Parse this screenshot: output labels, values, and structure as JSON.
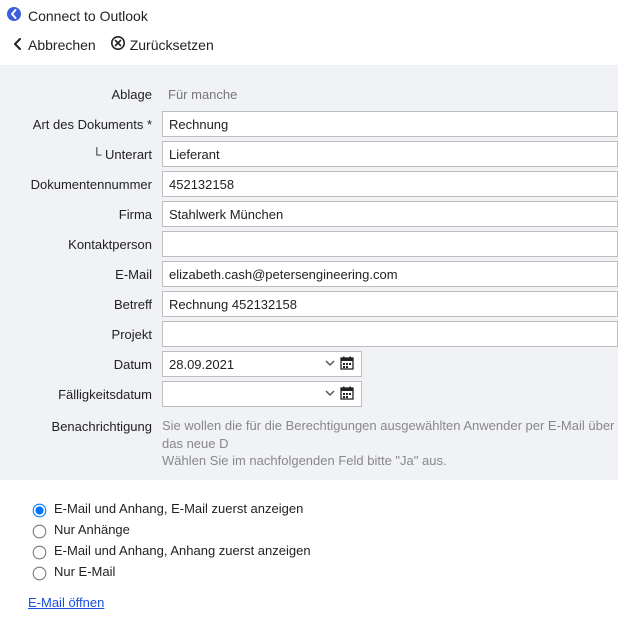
{
  "window": {
    "title": "Connect to Outlook"
  },
  "toolbar": {
    "cancel": "Abbrechen",
    "reset": "Zurücksetzen"
  },
  "form": {
    "ablage": {
      "label": "Ablage",
      "value": "Für manche"
    },
    "art": {
      "label": "Art des Dokuments *",
      "value": "Rechnung"
    },
    "unterart": {
      "label": "└ Unterart",
      "value": "Lieferant"
    },
    "docnum": {
      "label": "Dokumentennummer",
      "value": "452132158"
    },
    "firma": {
      "label": "Firma",
      "value": "Stahlwerk München"
    },
    "kontakt": {
      "label": "Kontaktperson",
      "value": ""
    },
    "email": {
      "label": "E-Mail",
      "value": "elizabeth.cash@petersengineering.com"
    },
    "betreff": {
      "label": "Betreff",
      "value": "Rechnung 452132158"
    },
    "projekt": {
      "label": "Projekt",
      "value": ""
    },
    "datum": {
      "label": "Datum",
      "value": "28.09.2021"
    },
    "faellig": {
      "label": "Fälligkeitsdatum",
      "value": ""
    },
    "benachrichtigung": {
      "label": "Benachrichtigung",
      "line1": "Sie wollen die für die Berechtigungen ausgewählten Anwender per E-Mail über das neue D",
      "line2": "Wählen Sie im nachfolgenden Feld bitte \"Ja\" aus."
    }
  },
  "options": {
    "o1": "E-Mail und Anhang, E-Mail zuerst anzeigen",
    "o2": "Nur Anhänge",
    "o3": "E-Mail und Anhang, Anhang zuerst anzeigen",
    "o4": "Nur E-Mail",
    "selected": "o1"
  },
  "link": {
    "open_email": "E-Mail öffnen"
  }
}
